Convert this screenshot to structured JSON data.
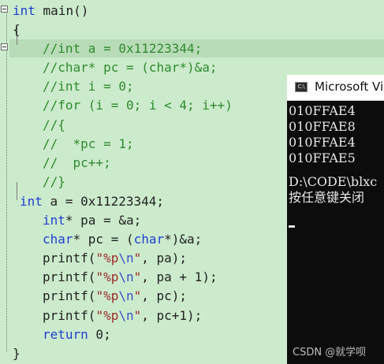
{
  "editor": {
    "lines": [
      {
        "id": "l1",
        "segs": [
          {
            "t": "int",
            "c": "kw"
          },
          {
            "t": " main()",
            "c": ""
          }
        ]
      },
      {
        "id": "l2",
        "segs": [
          {
            "t": "{",
            "c": ""
          }
        ]
      },
      {
        "id": "l3",
        "segs": [
          {
            "t": "//int a = 0x11223344;",
            "c": "cm"
          }
        ]
      },
      {
        "id": "l4",
        "segs": [
          {
            "t": "//char* pc = (char*)&a;",
            "c": "cm"
          }
        ]
      },
      {
        "id": "l5",
        "segs": [
          {
            "t": "//int i = 0;",
            "c": "cm"
          }
        ]
      },
      {
        "id": "l6",
        "segs": [
          {
            "t": "//for (i = 0; i < 4; i++)",
            "c": "cm"
          }
        ]
      },
      {
        "id": "l7",
        "segs": [
          {
            "t": "//{",
            "c": "cm"
          }
        ]
      },
      {
        "id": "l8",
        "segs": [
          {
            "t": "//  *pc = 1;",
            "c": "cm"
          }
        ]
      },
      {
        "id": "l9",
        "segs": [
          {
            "t": "//  pc++;",
            "c": "cm"
          }
        ]
      },
      {
        "id": "l10",
        "segs": [
          {
            "t": "//}",
            "c": "cm"
          }
        ]
      },
      {
        "id": "l11",
        "segs": [
          {
            "t": "int",
            "c": "kw"
          },
          {
            "t": " a = 0x11223344;",
            "c": ""
          }
        ]
      },
      {
        "id": "l12",
        "segs": [
          {
            "t": "int",
            "c": "kw"
          },
          {
            "t": "* pa = &a;",
            "c": ""
          }
        ]
      },
      {
        "id": "l13",
        "segs": [
          {
            "t": "char",
            "c": "kw"
          },
          {
            "t": "* pc = (",
            "c": ""
          },
          {
            "t": "char",
            "c": "kw"
          },
          {
            "t": "*)&a;",
            "c": ""
          }
        ]
      },
      {
        "id": "l14",
        "segs": [
          {
            "t": "printf(",
            "c": ""
          },
          {
            "t": "\"%p",
            "c": "str"
          },
          {
            "t": "\\n",
            "c": "esc"
          },
          {
            "t": "\"",
            "c": "str"
          },
          {
            "t": ", pa);",
            "c": ""
          }
        ]
      },
      {
        "id": "l15",
        "segs": [
          {
            "t": "printf(",
            "c": ""
          },
          {
            "t": "\"%p",
            "c": "str"
          },
          {
            "t": "\\n",
            "c": "esc"
          },
          {
            "t": "\"",
            "c": "str"
          },
          {
            "t": ", pa + 1);",
            "c": ""
          }
        ]
      },
      {
        "id": "l16",
        "segs": [
          {
            "t": "printf(",
            "c": ""
          },
          {
            "t": "\"%p",
            "c": "str"
          },
          {
            "t": "\\n",
            "c": "esc"
          },
          {
            "t": "\"",
            "c": "str"
          },
          {
            "t": ", pc);",
            "c": ""
          }
        ]
      },
      {
        "id": "l17",
        "segs": [
          {
            "t": "printf(",
            "c": ""
          },
          {
            "t": "\"%p",
            "c": "str"
          },
          {
            "t": "\\n",
            "c": "esc"
          },
          {
            "t": "\"",
            "c": "str"
          },
          {
            "t": ", pc+1);",
            "c": ""
          }
        ]
      },
      {
        "id": "l18",
        "segs": [
          {
            "t": "return",
            "c": "kw"
          },
          {
            "t": " 0;",
            "c": ""
          }
        ]
      },
      {
        "id": "l19",
        "segs": [
          {
            "t": "}",
            "c": ""
          }
        ]
      }
    ]
  },
  "console": {
    "title": "Microsoft Vi",
    "icon_text": "C:\\",
    "lines": [
      "010FFAE4",
      "010FFAE8",
      "010FFAE4",
      "010FFAE5",
      "",
      "D:\\CODE\\blxc",
      "按任意键关闭"
    ]
  },
  "watermark": "CSDN @就学呗"
}
